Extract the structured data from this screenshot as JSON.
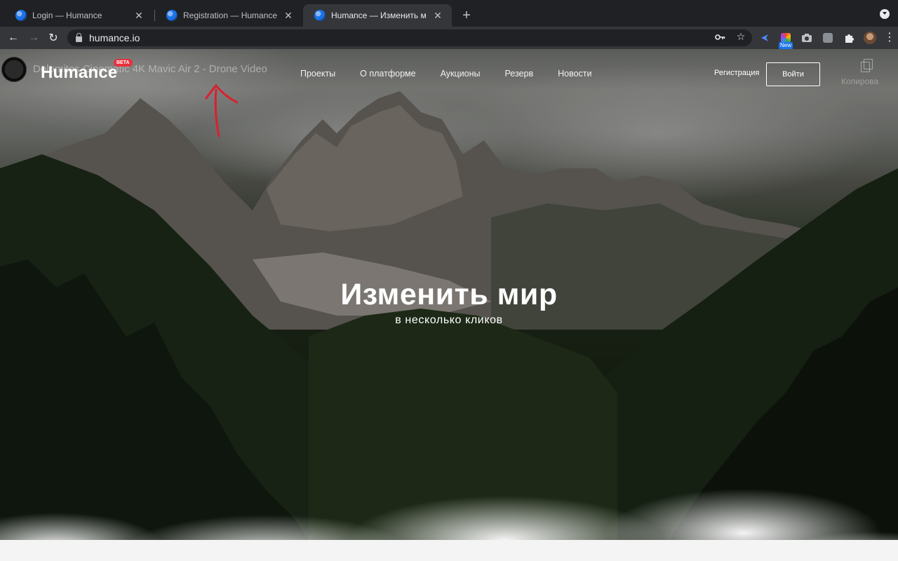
{
  "browser": {
    "tabs": [
      {
        "title": "Login — Humance",
        "active": false
      },
      {
        "title": "Registration — Humance",
        "active": false
      },
      {
        "title": "Humance — Изменить мир в н",
        "active": true
      }
    ],
    "new_tab": "+",
    "back": "←",
    "forward": "→",
    "reload": "↻",
    "url": "humance.io",
    "key_icon": "key-icon",
    "star": "☆",
    "ext_new_badge": "New",
    "menu": "⋮"
  },
  "site": {
    "video_title": "Dolomites Cinematic 4K Mavic Air 2 - Drone Video",
    "logo": "Humance",
    "beta": "BETA",
    "nav": [
      "Проекты",
      "О платформе",
      "Аукционы",
      "Резерв",
      "Новости"
    ],
    "register": "Регистрация",
    "login": "Войти",
    "copy_label": "Копирова"
  },
  "hero": {
    "title": "Изменить мир",
    "subtitle": "в несколько кликов"
  },
  "colors": {
    "beta_badge": "#e8303d",
    "arrow": "#d9202f",
    "chrome_dark": "#202124",
    "chrome_toolbar": "#35363a"
  }
}
